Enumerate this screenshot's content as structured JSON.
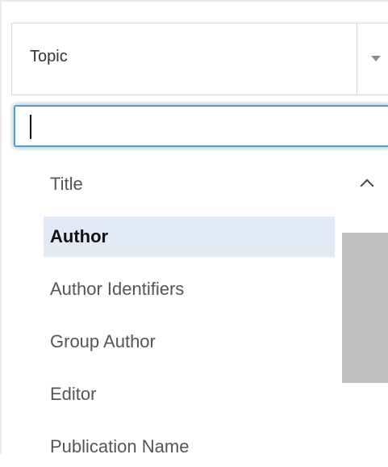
{
  "select": {
    "value": "Topic"
  },
  "search": {
    "value": "",
    "placeholder": ""
  },
  "options": [
    {
      "label": "Title",
      "active": false
    },
    {
      "label": "Author",
      "active": true
    },
    {
      "label": "Author Identifiers",
      "active": false
    },
    {
      "label": "Group Author",
      "active": false
    },
    {
      "label": "Editor",
      "active": false
    },
    {
      "label": "Publication Name",
      "active": false
    }
  ],
  "colors": {
    "focus_ring": "#5b9bc4",
    "active_option_bg": "#e2ebf5",
    "scroll_thumb": "#c1c1c1"
  },
  "icons": [
    "dropdown-caret-icon",
    "scroll-up-icon"
  ]
}
